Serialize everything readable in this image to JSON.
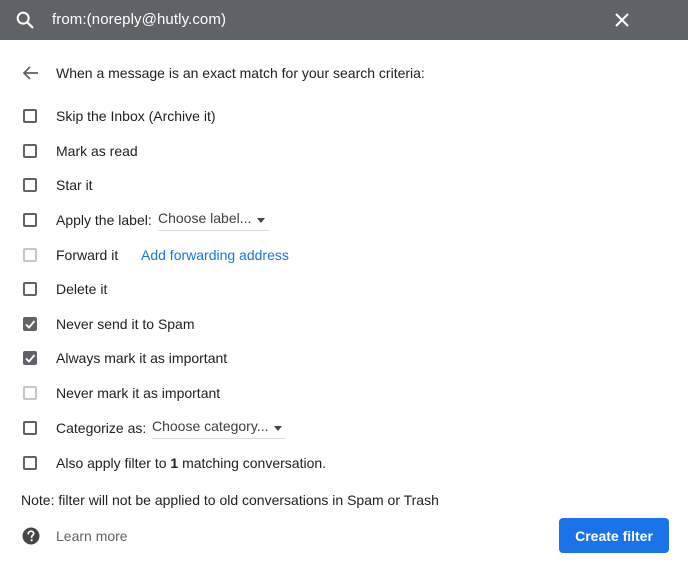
{
  "search": {
    "query": "from:(noreply@hutly.com)",
    "search_icon": "search-icon",
    "close_icon": "close-icon"
  },
  "header": {
    "back_icon": "arrow-back-icon",
    "text": "When a message is an exact match for your search criteria:"
  },
  "options": [
    {
      "label": "Skip the Inbox (Archive it)",
      "checked": false,
      "disabled": false
    },
    {
      "label": "Mark as read",
      "checked": false,
      "disabled": false
    },
    {
      "label": "Star it",
      "checked": false,
      "disabled": false
    },
    {
      "label": "Apply the label:",
      "checked": false,
      "disabled": false,
      "dropdown": "Choose label..."
    },
    {
      "label": "Forward it",
      "checked": false,
      "disabled": true,
      "link": "Add forwarding address"
    },
    {
      "label": "Delete it",
      "checked": false,
      "disabled": false
    },
    {
      "label": "Never send it to Spam",
      "checked": true,
      "disabled": false
    },
    {
      "label": "Always mark it as important",
      "checked": true,
      "disabled": false
    },
    {
      "label": "Never mark it as important",
      "checked": false,
      "disabled": true
    },
    {
      "label": "Categorize as:",
      "checked": false,
      "disabled": false,
      "dropdown": "Choose category..."
    },
    {
      "label_prefix": "Also apply filter to",
      "count": "1",
      "label_suffix": "matching conversation.",
      "checked": false,
      "disabled": false
    }
  ],
  "note": "Note: filter will not be applied to old conversations in Spam or Trash",
  "footer": {
    "help_icon": "help-icon",
    "learn_more": "Learn more",
    "create_filter": "Create filter"
  },
  "colors": {
    "topbar": "#5f6368",
    "accent": "#1a73e8",
    "checkbox": "#5f6368",
    "checkbox_disabled": "#c6c6c6"
  }
}
